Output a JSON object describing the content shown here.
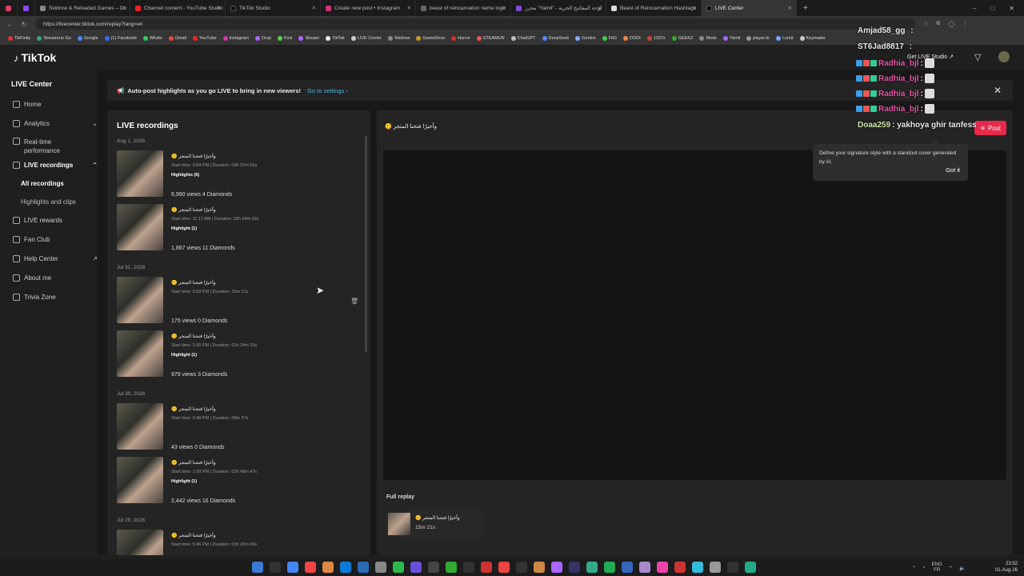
{
  "browser": {
    "tabs": [
      {
        "label": "",
        "color": "#e03a5e"
      },
      {
        "label": "",
        "color": "#9146ff"
      },
      {
        "label": "Skidrow & Reloaded Games – Do",
        "color": "#888"
      },
      {
        "label": "Channel content - YouTube Studio",
        "color": "#e22"
      },
      {
        "label": "TikTok Studio",
        "color": "#111"
      },
      {
        "label": "Create new post • Instagram",
        "color": "#d6307c"
      },
      {
        "label": "beast of reincarnation name logo",
        "color": "#666"
      },
      {
        "label": "محرر \"Yamil\" - لوحة المفاتيح الحرية",
        "color": "#7b4fd8"
      },
      {
        "label": "Beast of Reincarnation Hashtags",
        "color": "#ddd"
      },
      {
        "label": "LIVE Center",
        "color": "#111"
      }
    ],
    "new_tab": "+",
    "window_controls": [
      "–",
      "□",
      "✕"
    ],
    "url": "https://livecenter.tiktok.com/replay?lang=en",
    "bookmarks": [
      "TikFinity",
      "Streamrun Go",
      "Google",
      "(1) Facebook",
      "Whats",
      "Gmail",
      "YouTube",
      "Instagram",
      "Drop",
      "Kick",
      "Stream",
      "TikTok",
      "LIVE Center",
      "Skidrow",
      "GameDrive",
      "Horror",
      "STEAMUN",
      "ChatGPT",
      "DeepSeek",
      "Gemini",
      "FitG",
      "DODI",
      "1337x",
      "GEEKZ",
      "Mods",
      "Yamil",
      "player.kr",
      "Lurkit",
      "Keymailer"
    ]
  },
  "header": {
    "logo": "TikTok",
    "get_live_studio": "Get LIVE Studio ↗"
  },
  "sidebar": {
    "title": "LIVE Center",
    "items": [
      {
        "label": "Home"
      },
      {
        "label": "Analytics"
      },
      {
        "label": "Real-time performance"
      },
      {
        "label": "LIVE recordings"
      },
      {
        "label": "All recordings"
      },
      {
        "label": "Highlights and clips"
      },
      {
        "label": "LIVE rewards"
      },
      {
        "label": "Fan Club"
      },
      {
        "label": "Help Center"
      },
      {
        "label": "About me"
      },
      {
        "label": "Trivia Zone"
      }
    ]
  },
  "banner": {
    "text": "Auto-post highlights as you go LIVE to bring in new viewers!",
    "link": "Go to settings ›",
    "close": "✕"
  },
  "recordings": {
    "title": "LIVE recordings",
    "dates": [
      "Aug 1, 2026",
      "Jul 31, 2026",
      "Jul 30, 2026",
      "Jul 29, 2026"
    ],
    "items": [
      {
        "title": "وأخيرًا فتحنا المتجر",
        "emoji": "🤫",
        "meta": "Start time: 3:04 PM | Duration: 03h 37m 51s",
        "highlight": "Highlights (6)",
        "stats": "6,990 views  4 Diamonds"
      },
      {
        "title": "وأخيرًا فتحنا المتجر",
        "emoji": "🤫",
        "meta": "Start time: 11:17 AM | Duration: 02h 04m 02s",
        "highlight": "Highlight (1)",
        "stats": "1,867 views  11 Diamonds"
      },
      {
        "title": "وأخيرًا فتحنا المتجر",
        "emoji": "🤫",
        "meta": "Start time: 5:58 PM | Duration: 15m 21s",
        "highlight": "",
        "stats": "175 views  0 Diamonds"
      },
      {
        "title": "وأخيرًا فتحنا المتجر",
        "emoji": "🤫",
        "meta": "Start time: 2:35 PM | Duration: 01h 24m 33s",
        "highlight": "Highlight (1)",
        "stats": "979 views  3 Diamonds"
      },
      {
        "title": "وأخيرًا فتحنا المتجر",
        "emoji": "🤫",
        "meta": "Start time: 5:48 PM | Duration: 08m 57s",
        "highlight": "",
        "stats": "43 views  0 Diamonds"
      },
      {
        "title": "وأخيرًا فتحنا المتجر",
        "emoji": "🤫",
        "meta": "Start time: 1:29 PM | Duration: 02h 49m 47s",
        "highlight": "Highlight (1)",
        "stats": "2,442 views  16 Diamonds"
      },
      {
        "title": "وأخيرًا فتحنا المتجر",
        "emoji": "🤫",
        "meta": "Start time: 5:46 PM | Duration: 03h 20m 09s",
        "highlight": "",
        "stats": ""
      }
    ]
  },
  "detail": {
    "title": "وأخيرًا فتحنا المتجر",
    "emoji": "🤫",
    "post_button": "Post",
    "full_replay_label": "Full replay",
    "full_replay_title": "وأخيرًا فتحنا المتجر",
    "full_replay_duration": "15m 21s"
  },
  "tooltip": {
    "text": "Define your signature style with a standout cover generated by AI.",
    "button": "Got it"
  },
  "chat_overlay": [
    {
      "user": "Amjad58_gg",
      "text": ":",
      "color": "#e8e8e8"
    },
    {
      "user": "ST6Jad8817",
      "text": ":",
      "color": "#e8e8e8"
    },
    {
      "user": "Radhia_bjl",
      "text": ":",
      "color": "#e556a6"
    },
    {
      "user": "Radhia_bjl",
      "text": ":",
      "color": "#e556a6"
    },
    {
      "user": "Radhia_bjl",
      "text": ":",
      "color": "#e556a6"
    },
    {
      "user": "Radhia_bjl",
      "text": ":",
      "color": "#e556a6"
    },
    {
      "user": "Doaa259",
      "text": ": yakhoya ghir tanfess",
      "color": "#e8e8e8"
    }
  ],
  "taskbar": {
    "lang": "ENG",
    "lang2": "FR",
    "time": "23:52",
    "date": "01-Aug-26"
  }
}
